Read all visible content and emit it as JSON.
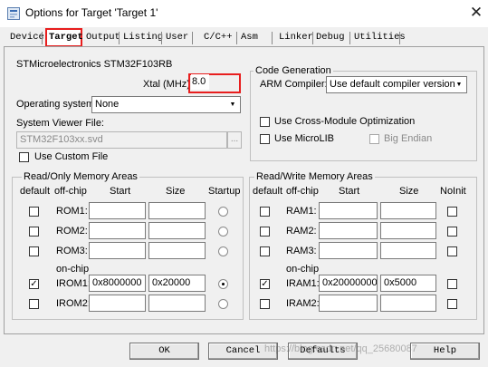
{
  "window": {
    "title": "Options for Target 'Target 1'",
    "close_glyph": "✕"
  },
  "tabs": [
    {
      "label": "Device"
    },
    {
      "label": "Target"
    },
    {
      "label": "Output"
    },
    {
      "label": "Listing"
    },
    {
      "label": "User"
    },
    {
      "label": "C/C++"
    },
    {
      "label": "Asm"
    },
    {
      "label": "Linker"
    },
    {
      "label": "Debug"
    },
    {
      "label": "Utilities"
    }
  ],
  "active_tab": "Target",
  "device": {
    "name": "STMicroelectronics STM32F103RB",
    "xtal_label": "Xtal (MHz):",
    "xtal_value": "8.0"
  },
  "os": {
    "label": "Operating system:",
    "value": "None"
  },
  "svd": {
    "label": "System Viewer File:",
    "value": "STM32F103xx.svd",
    "browse_label": "...",
    "custom_label": "Use Custom File",
    "custom_checked": false
  },
  "codegen": {
    "title": "Code Generation",
    "compiler_label": "ARM Compiler:",
    "compiler_value": "Use default compiler version",
    "cross_module_label": "Use Cross-Module Optimization",
    "cross_module_checked": false,
    "microlib_label": "Use MicroLIB",
    "microlib_checked": false,
    "big_endian_label": "Big Endian",
    "big_endian_checked": false
  },
  "ro_memory": {
    "title": "Read/Only Memory Areas",
    "headers": {
      "default": "default",
      "offchip": "off-chip",
      "start": "Start",
      "size": "Size",
      "startup": "Startup"
    },
    "onchip_label": "on-chip",
    "rows": [
      {
        "name": "ROM1:",
        "default": false,
        "start": "",
        "size": "",
        "startup": false
      },
      {
        "name": "ROM2:",
        "default": false,
        "start": "",
        "size": "",
        "startup": false
      },
      {
        "name": "ROM3:",
        "default": false,
        "start": "",
        "size": "",
        "startup": false
      },
      {
        "name": "IROM1:",
        "default": true,
        "start": "0x8000000",
        "size": "0x20000",
        "startup": true
      },
      {
        "name": "IROM2:",
        "default": false,
        "start": "",
        "size": "",
        "startup": false
      }
    ]
  },
  "rw_memory": {
    "title": "Read/Write Memory Areas",
    "headers": {
      "default": "default",
      "offchip": "off-chip",
      "start": "Start",
      "size": "Size",
      "noinit": "NoInit"
    },
    "onchip_label": "on-chip",
    "rows": [
      {
        "name": "RAM1:",
        "default": false,
        "start": "",
        "size": "",
        "noinit": false
      },
      {
        "name": "RAM2:",
        "default": false,
        "start": "",
        "size": "",
        "noinit": false
      },
      {
        "name": "RAM3:",
        "default": false,
        "start": "",
        "size": "",
        "noinit": false
      },
      {
        "name": "IRAM1:",
        "default": true,
        "start": "0x20000000",
        "size": "0x5000",
        "noinit": false
      },
      {
        "name": "IRAM2:",
        "default": false,
        "start": "",
        "size": "",
        "noinit": false
      }
    ]
  },
  "buttons": {
    "ok": "OK",
    "cancel": "Cancel",
    "defaults": "Defaults",
    "help": "Help"
  },
  "watermark": "https://blog.csdn.net/qq_25680087",
  "colors": {
    "highlight": "#e81e1e",
    "dialog_bg": "#f0f0f0"
  }
}
